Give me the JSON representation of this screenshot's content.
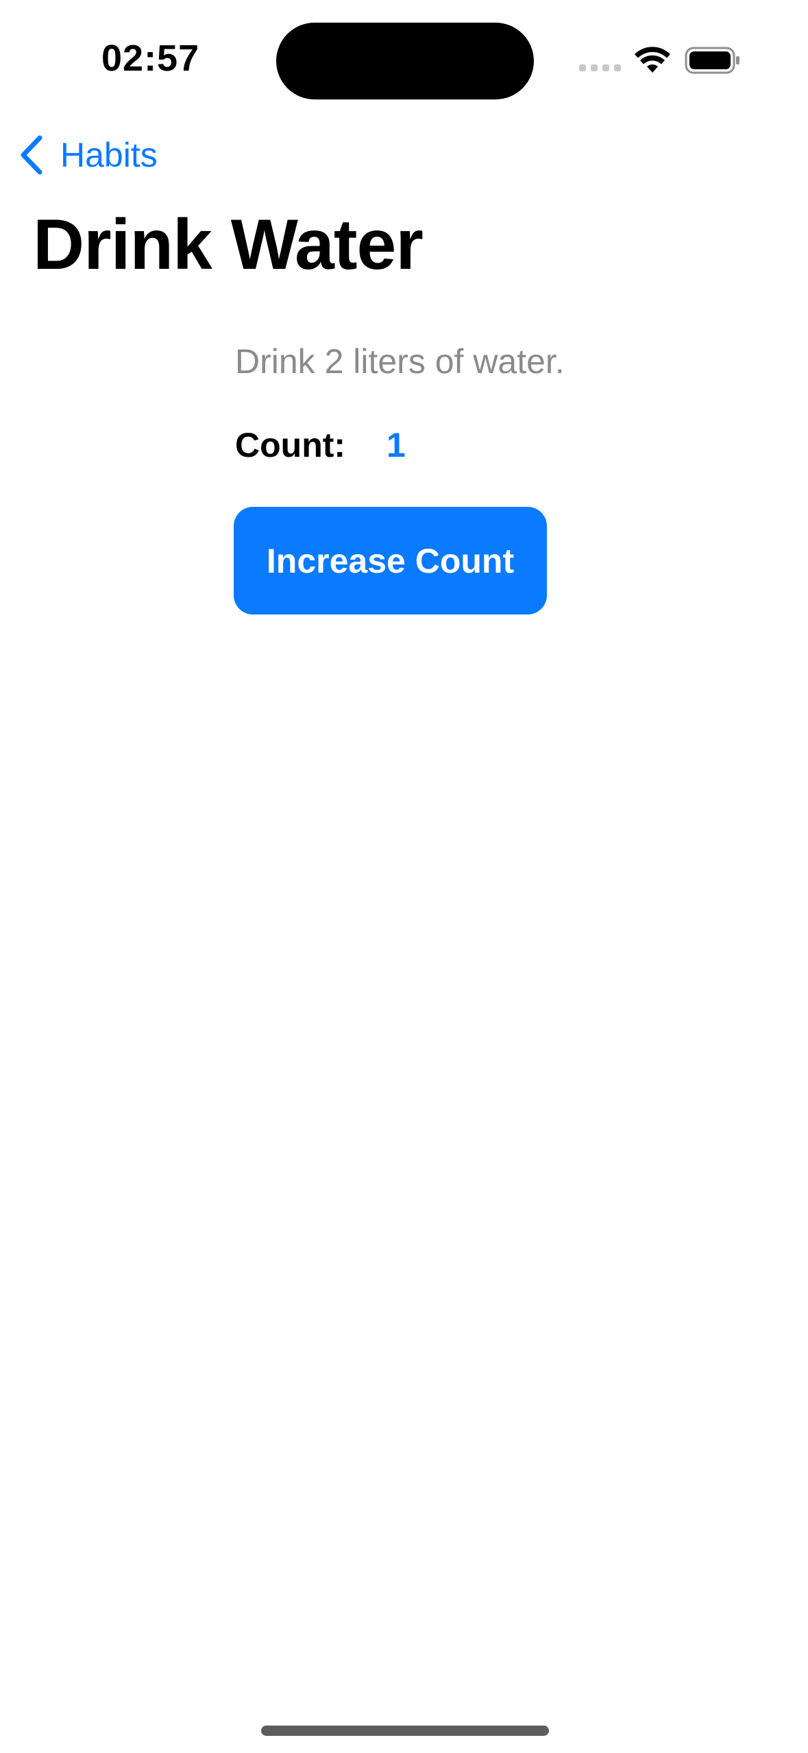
{
  "status_bar": {
    "time": "02:57",
    "icons": [
      "cellular-signal-icon",
      "wifi-icon",
      "battery-icon"
    ]
  },
  "nav": {
    "back_label": "Habits",
    "back_icon": "chevron-left-icon"
  },
  "habit": {
    "title": "Drink Water",
    "description": "Drink 2 liters of water.",
    "count_label": "Count:",
    "count_value": "1"
  },
  "actions": {
    "increase_label": "Increase Count"
  },
  "colors": {
    "accent": "#0a7aff",
    "secondary_text": "#8a8a8e",
    "background": "#ffffff"
  }
}
